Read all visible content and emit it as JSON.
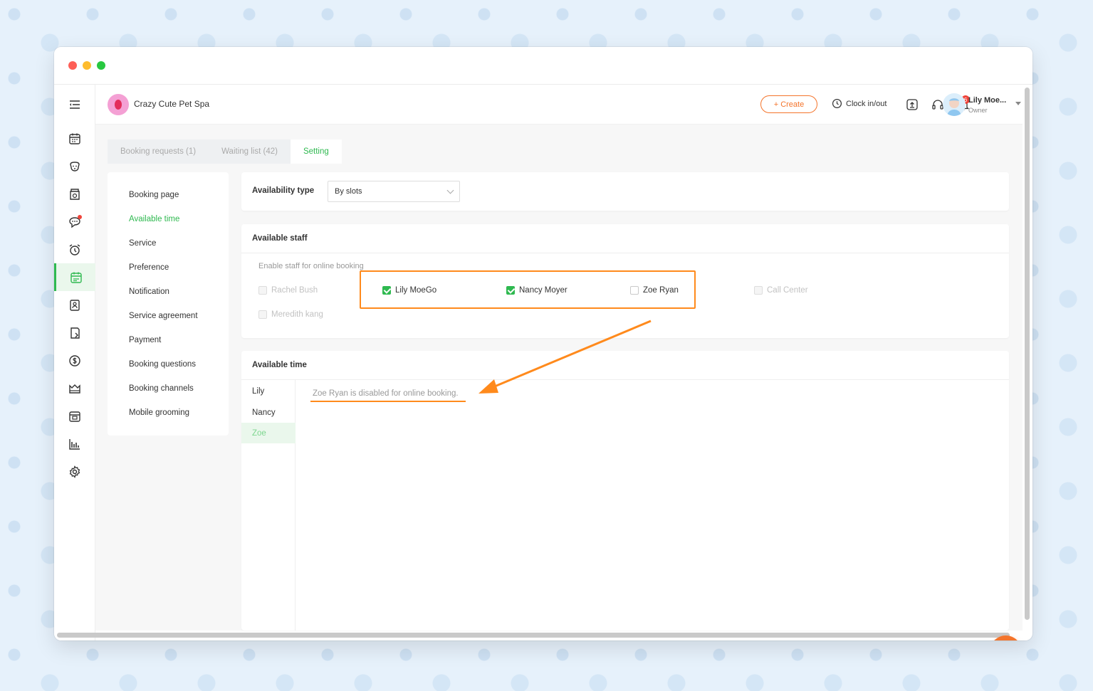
{
  "app": {
    "business_name": "Crazy Cute Pet Spa"
  },
  "topbar": {
    "create_label": "Create",
    "clock_label": "Clock in/out",
    "notification_count": "6",
    "user_name": "Lily Moe...",
    "user_role": "Owner"
  },
  "tabs": [
    {
      "label": "Booking requests (1)"
    },
    {
      "label": "Waiting list (42)"
    },
    {
      "label": "Setting"
    }
  ],
  "settings_menu": [
    {
      "label": "Booking page"
    },
    {
      "label": "Available time"
    },
    {
      "label": "Service"
    },
    {
      "label": "Preference"
    },
    {
      "label": "Notification"
    },
    {
      "label": "Service agreement"
    },
    {
      "label": "Payment"
    },
    {
      "label": "Booking questions"
    },
    {
      "label": "Booking channels"
    },
    {
      "label": "Mobile grooming"
    }
  ],
  "availability": {
    "label": "Availability type",
    "value": "By slots"
  },
  "available_staff": {
    "title": "Available staff",
    "subtitle": "Enable staff for online booking",
    "staff": [
      {
        "name": "Rachel Bush",
        "checked": false,
        "disabled": true
      },
      {
        "name": "Lily MoeGo",
        "checked": true,
        "disabled": false
      },
      {
        "name": "Nancy Moyer",
        "checked": true,
        "disabled": false
      },
      {
        "name": "Zoe Ryan",
        "checked": false,
        "disabled": false
      },
      {
        "name": "Call Center",
        "checked": false,
        "disabled": true
      },
      {
        "name": "Meredith kang",
        "checked": false,
        "disabled": true
      }
    ]
  },
  "available_time": {
    "title": "Available time",
    "staff_tabs": [
      {
        "label": "Lily"
      },
      {
        "label": "Nancy"
      },
      {
        "label": "Zoe"
      }
    ],
    "message": "Zoe Ryan is disabled for online booking."
  },
  "colors": {
    "accent_green": "#2fb950",
    "accent_orange": "#f4742b",
    "annotation_orange": "#ff8a1c"
  }
}
